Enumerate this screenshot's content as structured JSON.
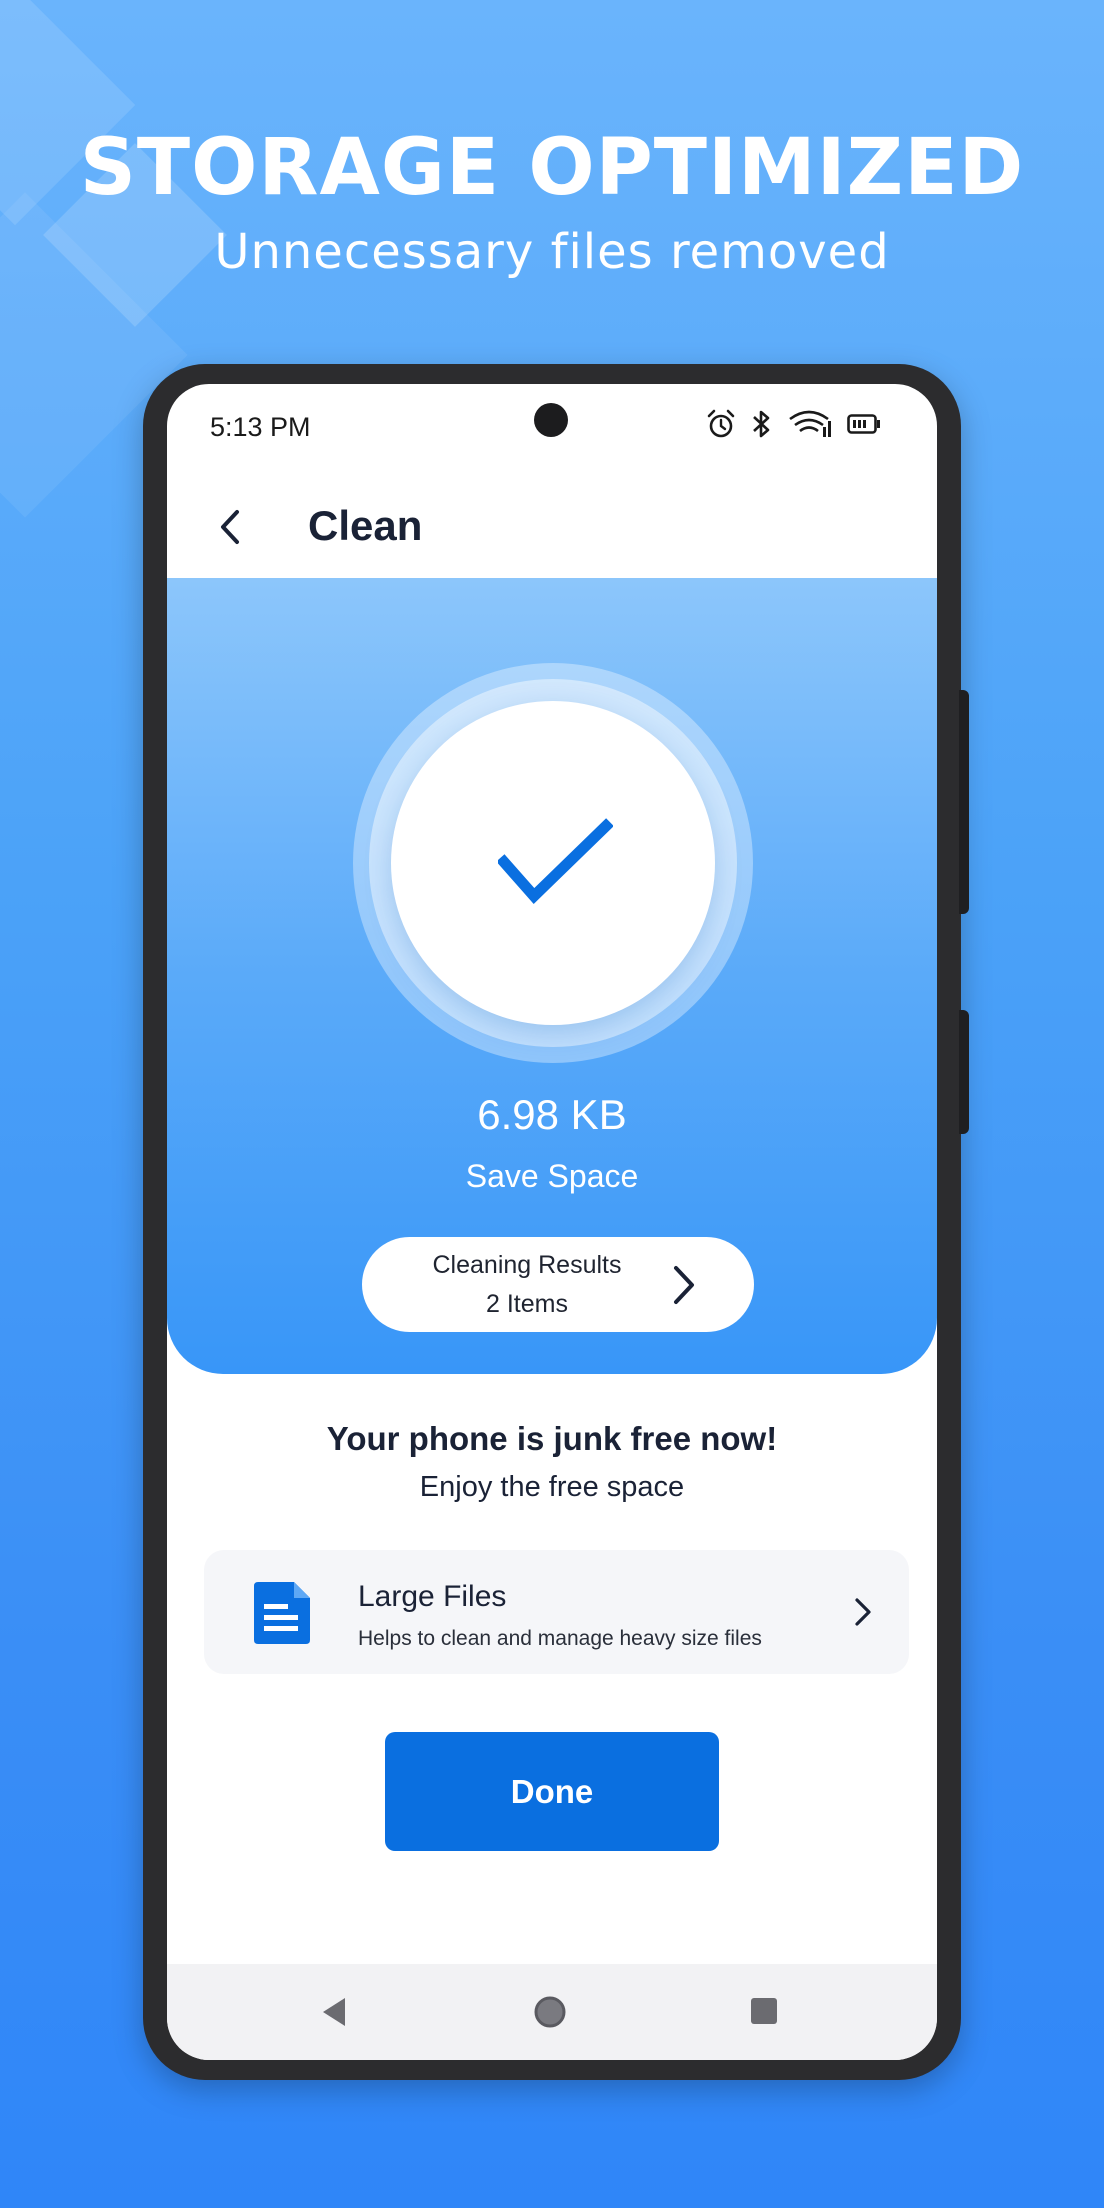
{
  "promo": {
    "headline": "STORAGE OPTIMIZED",
    "subheadline": "Unnecessary files removed"
  },
  "statusbar": {
    "time": "5:13 PM",
    "icons": [
      "alarm-icon",
      "bluetooth-icon",
      "wifi-icon",
      "battery-icon"
    ]
  },
  "appbar": {
    "title": "Clean"
  },
  "result": {
    "size": "6.98 KB",
    "label": "Save Space",
    "results_title": "Cleaning Results",
    "results_count": "2 Items"
  },
  "message": {
    "title": "Your phone is junk free now!",
    "subtitle": "Enjoy the free space"
  },
  "feature": {
    "title": "Large Files",
    "description": "Helps to clean and manage heavy size files"
  },
  "actions": {
    "done_label": "Done"
  },
  "colors": {
    "accent": "#0a6fe0",
    "hero_top": "#8cc6fb",
    "hero_bottom": "#3896f8",
    "background": "#4ba2f8"
  }
}
